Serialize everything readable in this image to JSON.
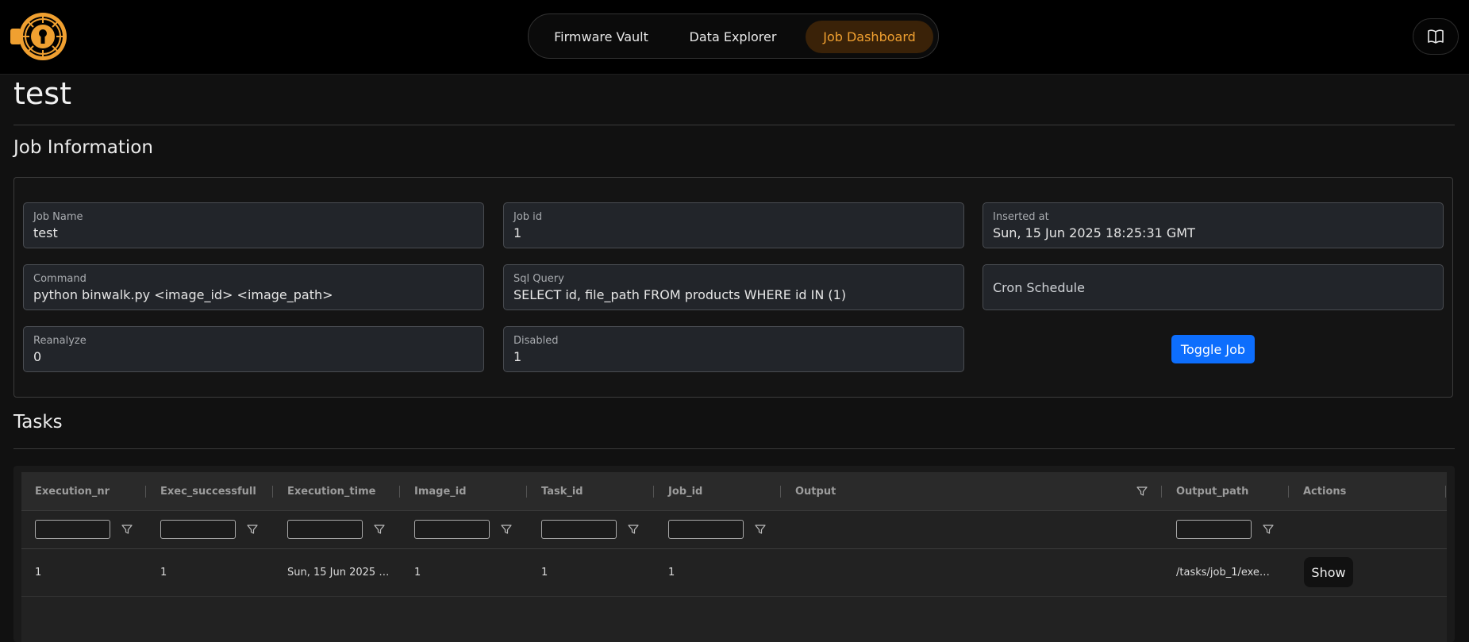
{
  "nav": {
    "items": [
      {
        "label": "Firmware Vault"
      },
      {
        "label": "Data Explorer"
      },
      {
        "label": "Job Dashboard",
        "active": true
      }
    ],
    "accent_color": "#f0a030",
    "icons": {
      "logo": "keyhole-chip-logo",
      "docs": "book-icon"
    }
  },
  "page": {
    "title": "test"
  },
  "job_info": {
    "section_title": "Job Information",
    "fields": {
      "job_name": {
        "label": "Job Name",
        "value": "test"
      },
      "job_id": {
        "label": "Job id",
        "value": "1"
      },
      "inserted_at": {
        "label": "Inserted at",
        "value": "Sun, 15 Jun 2025 18:25:31 GMT"
      },
      "command": {
        "label": "Command",
        "value": "python binwalk.py <image_id> <image_path>"
      },
      "sql_query": {
        "label": "Sql Query",
        "value": "SELECT id, file_path FROM products WHERE id IN (1)"
      },
      "cron_schedule": {
        "placeholder": "Cron Schedule"
      },
      "reanalyze": {
        "label": "Reanalyze",
        "value": "0"
      },
      "disabled": {
        "label": "Disabled",
        "value": "1"
      }
    },
    "toggle_label": "Toggle Job",
    "toggle_color": "#0d6efd"
  },
  "tasks": {
    "section_title": "Tasks",
    "columns": [
      "Execution_nr",
      "Exec_successfull",
      "Execution_time",
      "Image_id",
      "Task_id",
      "Job_id",
      "Output",
      "Output_path",
      "Actions"
    ],
    "rows": [
      {
        "execution_nr": "1",
        "exec_successfull": "1",
        "execution_time": "Sun, 15 Jun 2025 …",
        "image_id": "1",
        "task_id": "1",
        "job_id": "1",
        "output": "",
        "output_path": "/tasks/job_1/exe…",
        "action_label": "Show"
      }
    ]
  }
}
